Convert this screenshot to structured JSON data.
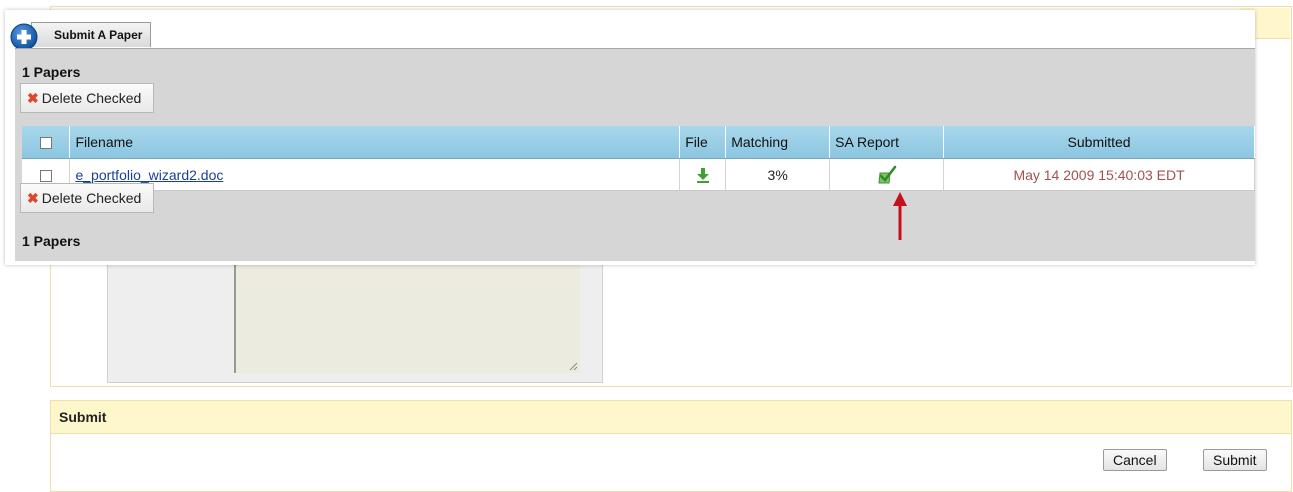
{
  "tab": {
    "label": "Submit A Paper"
  },
  "papers": {
    "count_label": "1 Papers",
    "delete_label": "Delete Checked",
    "columns": [
      "Filename",
      "File",
      "Matching",
      "SA Report",
      "Submitted"
    ],
    "rows": [
      {
        "filename": "e_portfolio_wizard2.doc",
        "file_icon": "download-arrow-icon",
        "matching": "3%",
        "sa_report_icon": "checkmark-report-icon",
        "submitted": "May 14 2009 15:40:03 EDT"
      }
    ]
  },
  "submit_section": {
    "title": "Submit",
    "cancel_label": "Cancel",
    "submit_label": "Submit"
  },
  "colors": {
    "header_blue": "#98cce4",
    "section_yellow": "#fff7cc",
    "delete_red": "#e0442a",
    "icon_green": "#3da32f",
    "submitted_text": "#a45050",
    "annotation_arrow": "#c4111b"
  }
}
